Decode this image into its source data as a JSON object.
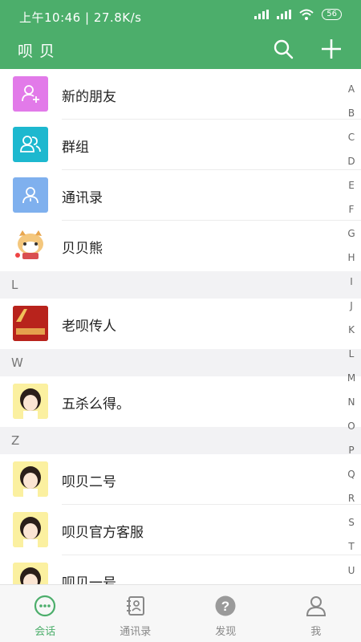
{
  "status": {
    "time": "上午10:46",
    "speed": "27.8K/s",
    "battery": "56"
  },
  "header": {
    "title": "呗贝"
  },
  "contacts_top": [
    {
      "label": "新的朋友",
      "icon": "add-user-icon",
      "color": "#e27ae9"
    },
    {
      "label": "群组",
      "icon": "group-icon",
      "color": "#1db8cf"
    },
    {
      "label": "通讯录",
      "icon": "phonebook-icon",
      "color": "#7fb0ee"
    },
    {
      "label": "贝贝熊",
      "icon": "bear-avatar"
    }
  ],
  "sections": [
    {
      "letter": "L",
      "items": [
        {
          "label": "老呗传人"
        }
      ]
    },
    {
      "letter": "W",
      "items": [
        {
          "label": "五杀么得。"
        }
      ]
    },
    {
      "letter": "Z",
      "items": [
        {
          "label": "呗贝二号"
        },
        {
          "label": "呗贝官方客服"
        },
        {
          "label": "呗贝一号"
        }
      ]
    }
  ],
  "alphabet": [
    "A",
    "B",
    "C",
    "D",
    "E",
    "F",
    "G",
    "H",
    "I",
    "J",
    "K",
    "L",
    "M",
    "N",
    "O",
    "P",
    "Q",
    "R",
    "S",
    "T",
    "U"
  ],
  "tabs": [
    {
      "label": "会话",
      "icon": "chat-icon"
    },
    {
      "label": "通讯录",
      "icon": "contacts-icon"
    },
    {
      "label": "发现",
      "icon": "discover-icon"
    },
    {
      "label": "我",
      "icon": "profile-icon"
    }
  ],
  "colors": {
    "brand": "#4cae6b",
    "tab_active": "#4cae6b",
    "tab_inactive": "#888888"
  }
}
